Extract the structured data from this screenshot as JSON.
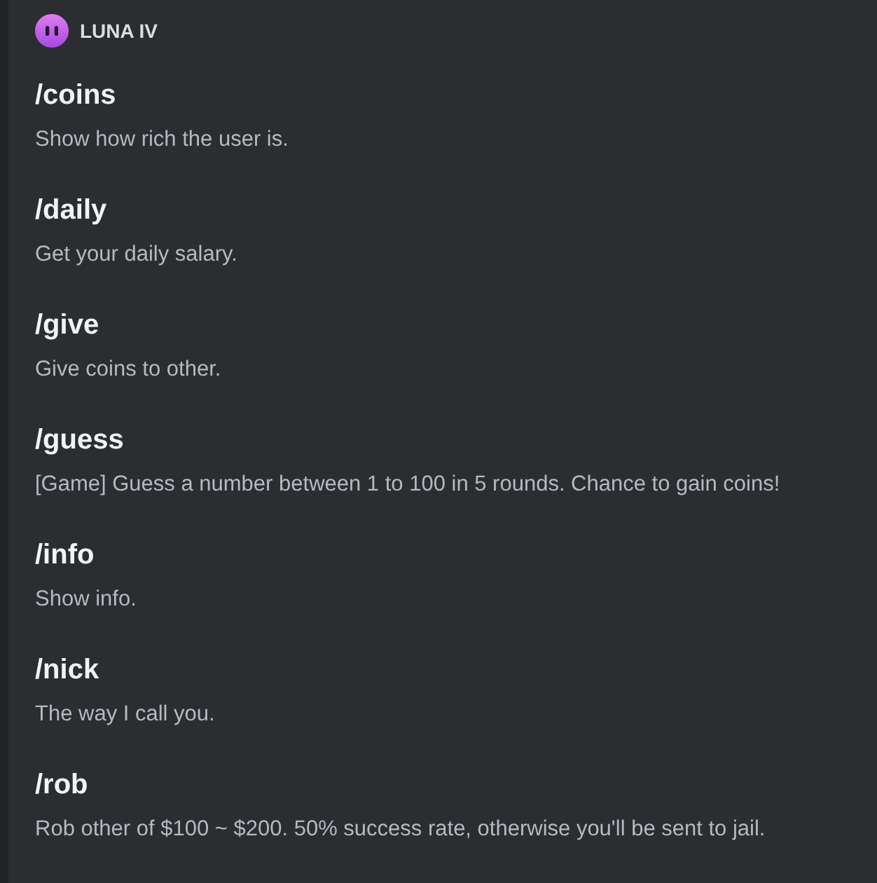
{
  "author": {
    "name": "LUNA IV"
  },
  "commands": [
    {
      "name": "/coins",
      "description": "Show how rich the user is."
    },
    {
      "name": "/daily",
      "description": "Get your daily salary."
    },
    {
      "name": "/give",
      "description": "Give coins to other."
    },
    {
      "name": "/guess",
      "description": "[Game] Guess a number between 1 to 100 in 5 rounds. Chance to gain coins!"
    },
    {
      "name": "/info",
      "description": "Show info."
    },
    {
      "name": "/nick",
      "description": "The way I call you."
    },
    {
      "name": "/rob",
      "description": "Rob other of $100 ~ $200. 50% success rate, otherwise you'll be sent to jail."
    }
  ]
}
